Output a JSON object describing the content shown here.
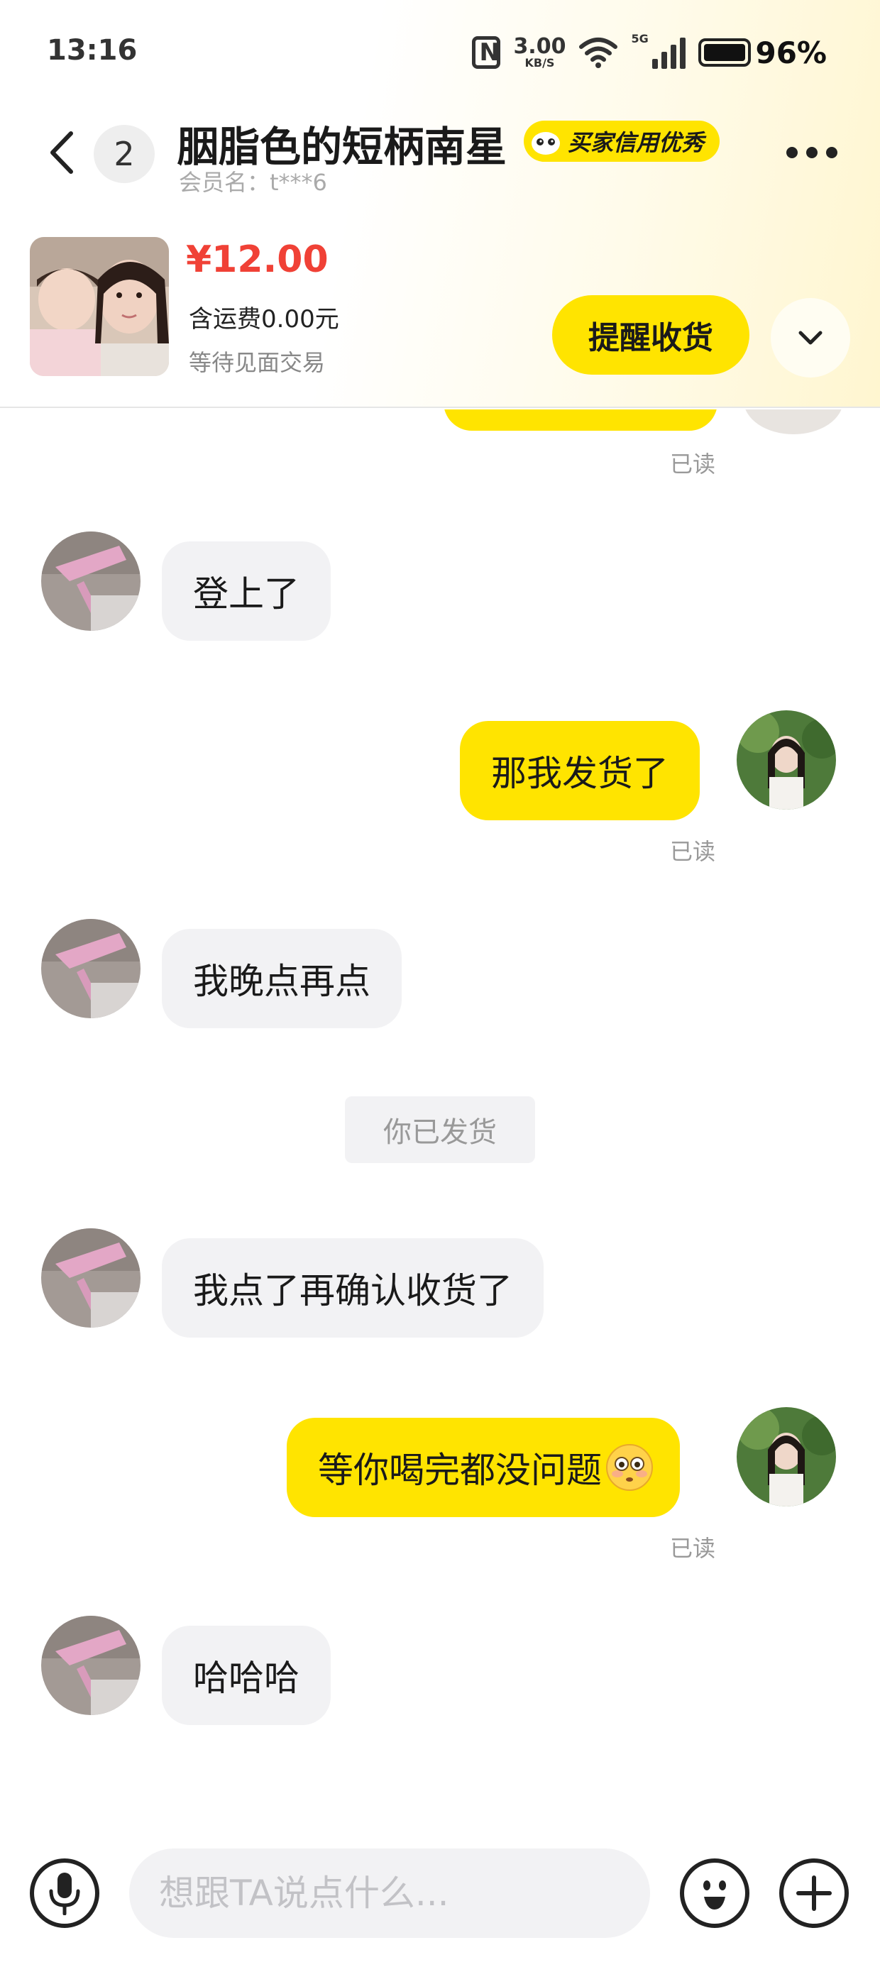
{
  "status_bar": {
    "time": "13:16",
    "net_speed_value": "3.00",
    "net_speed_unit": "KB/S",
    "network_type": "5G",
    "battery_percent": "96%"
  },
  "header": {
    "unread_count": "2",
    "contact_name": "胭脂色的短柄南星",
    "credit_badge": "买家信用优秀",
    "member_name": "会员名：t***6"
  },
  "product": {
    "price": "¥12.00",
    "shipping": "含运费0.00元",
    "trade_status": "等待见面交易",
    "remind_button": "提醒收货"
  },
  "messages": [
    {
      "side": "in",
      "text": "登上了"
    },
    {
      "side": "out",
      "text": "那我发货了",
      "read": "已读"
    },
    {
      "side": "in",
      "text": "我晚点再点"
    },
    {
      "side": "system",
      "text": "你已发货"
    },
    {
      "side": "in",
      "text": "我点了再确认收货了"
    },
    {
      "side": "out",
      "text": "等你喝完都没问题",
      "emoji": "flushed-face",
      "read": "已读"
    },
    {
      "side": "in",
      "text": "哈哈哈"
    }
  ],
  "top_read": "已读",
  "input": {
    "placeholder": "想跟TA说点什么..."
  },
  "colors": {
    "accent_yellow": "#ffe400",
    "price_red": "#f04136",
    "incoming_bubble": "#f2f2f4"
  }
}
